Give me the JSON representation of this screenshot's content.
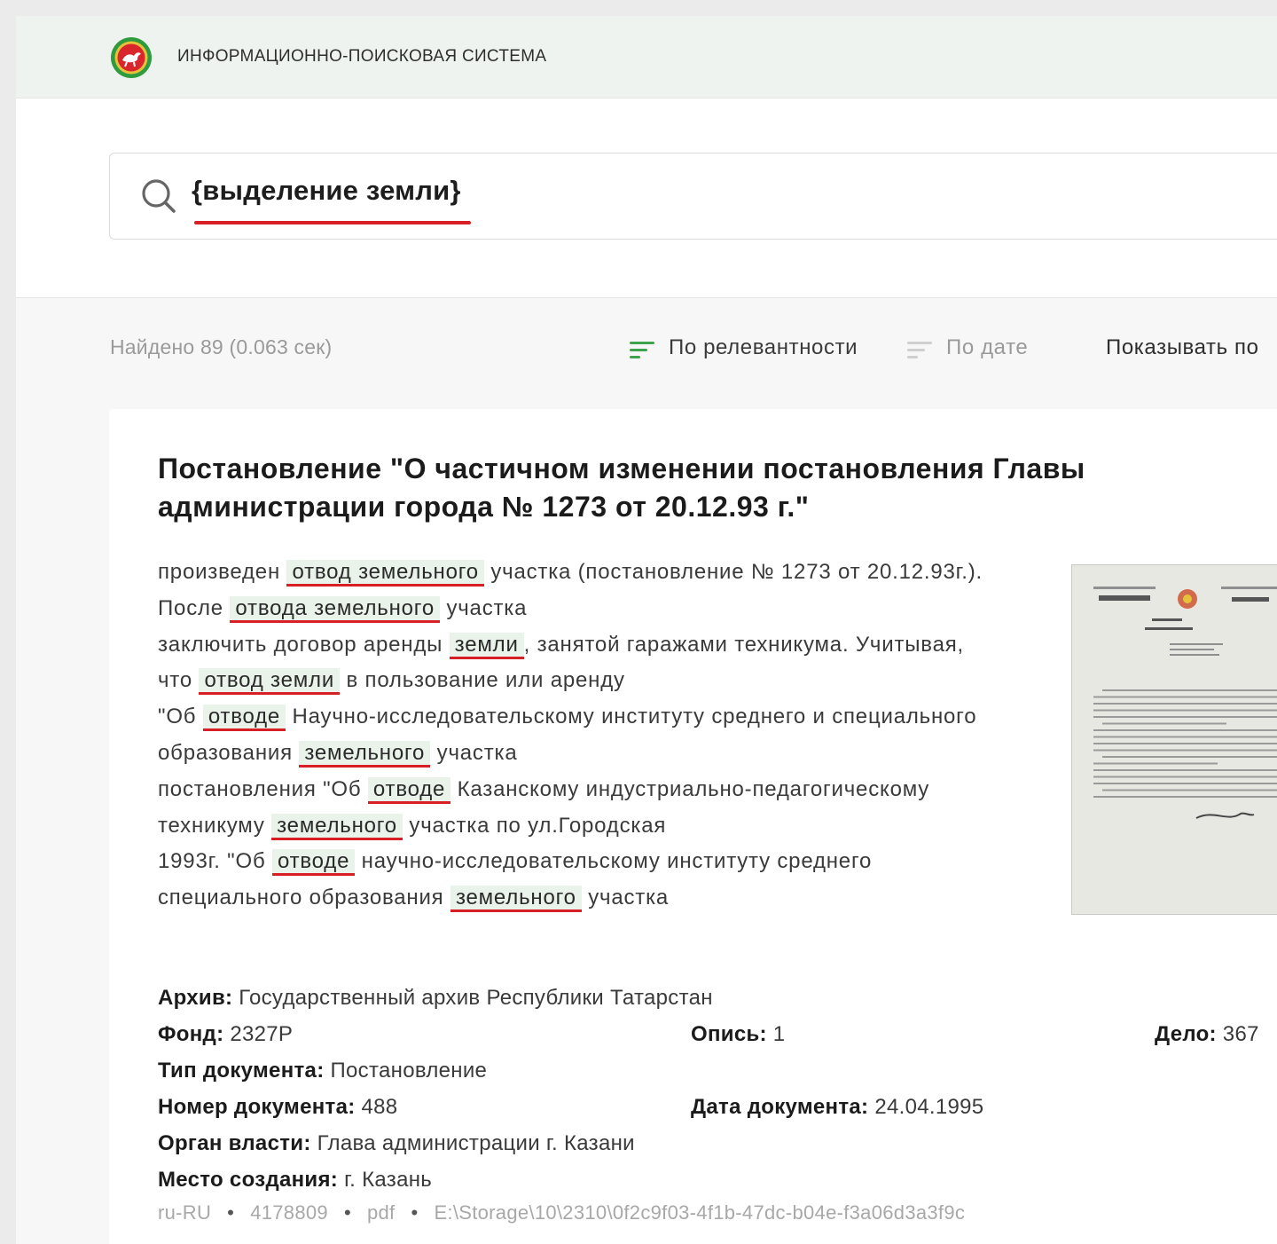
{
  "header": {
    "system_title": "ИНФОРМАЦИОННО-ПОИСКОВАЯ СИСТЕМА",
    "logo_icon": "tatarstan-emblem-icon"
  },
  "search": {
    "query": "{выделение земли}",
    "icon": "search-icon"
  },
  "results": {
    "found_text": "Найдено 89 (0.063 сек)",
    "sort_relevance": "По релевантности",
    "sort_date": "По дате",
    "show_label": "Показывать по"
  },
  "colors": {
    "accent_green": "#3fa34d",
    "highlight_bg": "#e9f3ea",
    "underline_red": "#d81f26"
  },
  "document": {
    "title": "Постановление \"О частичном изменении постановления Главы администрации города № 1273 от 20.12.93 г.\"",
    "snippet_lines": [
      [
        {
          "t": "произведен "
        },
        {
          "t": "отвод земельного",
          "hl": true
        },
        {
          "t": " участка (постановление № 1273 от 20.12.93г.)."
        }
      ],
      [
        {
          "t": "После "
        },
        {
          "t": "отвода земельного",
          "hl": true
        },
        {
          "t": " участка"
        }
      ],
      [
        {
          "t": "заключить договор аренды "
        },
        {
          "t": "земли",
          "hl": true
        },
        {
          "t": ", занятой гаражами техникума. Учитывая,"
        }
      ],
      [
        {
          "t": "что "
        },
        {
          "t": "отвод земли",
          "hl": true
        },
        {
          "t": " в пользование или аренду"
        }
      ],
      [
        {
          "t": "\"Об "
        },
        {
          "t": "отводе",
          "hl": true
        },
        {
          "t": " Научно-исследовательскому институту среднего и специального"
        }
      ],
      [
        {
          "t": "образования "
        },
        {
          "t": "земельного",
          "hl": true
        },
        {
          "t": " участка"
        }
      ],
      [
        {
          "t": "постановления \"Об "
        },
        {
          "t": "отводе",
          "hl": true
        },
        {
          "t": " Казанскому индустриально-педагогическому"
        }
      ],
      [
        {
          "t": "техникуму "
        },
        {
          "t": "земельного",
          "hl": true
        },
        {
          "t": " участка по ул.Городская"
        }
      ],
      [
        {
          "t": "1993г. \"Об "
        },
        {
          "t": "отводе",
          "hl": true
        },
        {
          "t": " научно-исследовательскому институту среднего"
        }
      ],
      [
        {
          "t": "специального образования "
        },
        {
          "t": "земельного",
          "hl": true
        },
        {
          "t": " участка"
        }
      ]
    ],
    "meta": {
      "archive_label": "Архив:",
      "archive": "Государственный архив Республики Татарстан",
      "fond_label": "Фонд:",
      "fond": "2327Р",
      "opis_label": "Опись:",
      "opis": "1",
      "delo_label": "Дело:",
      "delo": "367",
      "type_label": "Тип документа:",
      "type": "Постановление",
      "number_label": "Номер документа:",
      "number": "488",
      "date_label": "Дата документа:",
      "date": "24.04.1995",
      "authority_label": "Орган власти:",
      "authority": "Глава администрации г. Казани",
      "place_label": "Место создания:",
      "place": "г. Казань"
    },
    "footer": {
      "lang": "ru-RU",
      "id": "4178809",
      "format": "pdf",
      "path": "E:\\Storage\\10\\2310\\0f2c9f03-4f1b-47dc-b04e-f3a06d3a3f9c"
    }
  }
}
